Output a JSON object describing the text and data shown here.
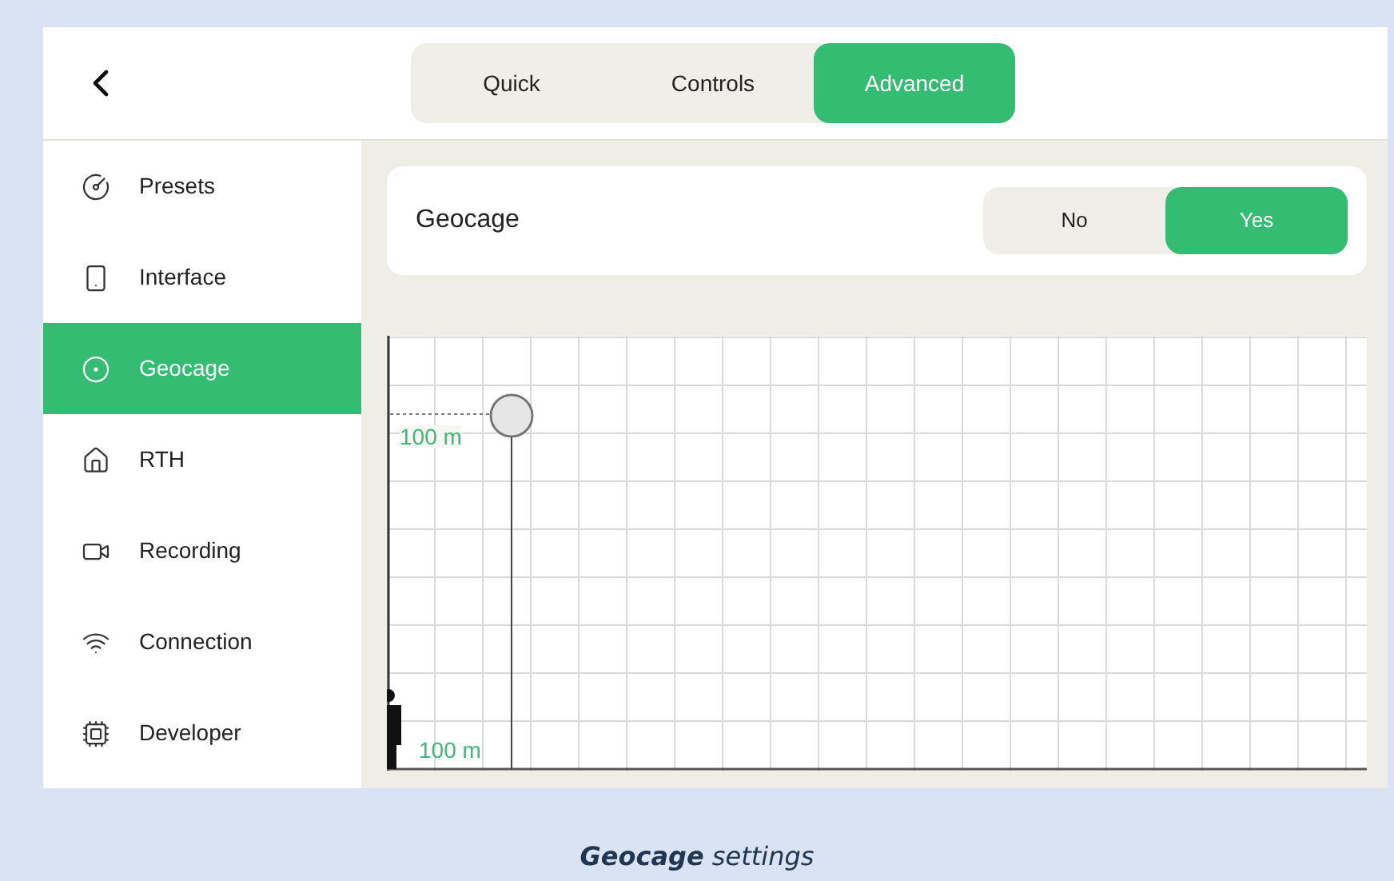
{
  "tabs": [
    {
      "label": "Quick",
      "selected": false
    },
    {
      "label": "Controls",
      "selected": false
    },
    {
      "label": "Advanced",
      "selected": true
    }
  ],
  "sidebar": {
    "items": [
      {
        "label": "Presets",
        "selected": false
      },
      {
        "label": "Interface",
        "selected": false
      },
      {
        "label": "Geocage",
        "selected": true
      },
      {
        "label": "RTH",
        "selected": false
      },
      {
        "label": "Recording",
        "selected": false
      },
      {
        "label": "Connection",
        "selected": false
      },
      {
        "label": "Developer",
        "selected": false
      }
    ]
  },
  "geocage": {
    "label": "Geocage",
    "options": [
      {
        "label": "No",
        "selected": false
      },
      {
        "label": "Yes",
        "selected": true
      }
    ]
  },
  "diagram": {
    "height_label": "100 m",
    "distance_label": "100 m"
  },
  "caption": "**Geocage** settings"
}
